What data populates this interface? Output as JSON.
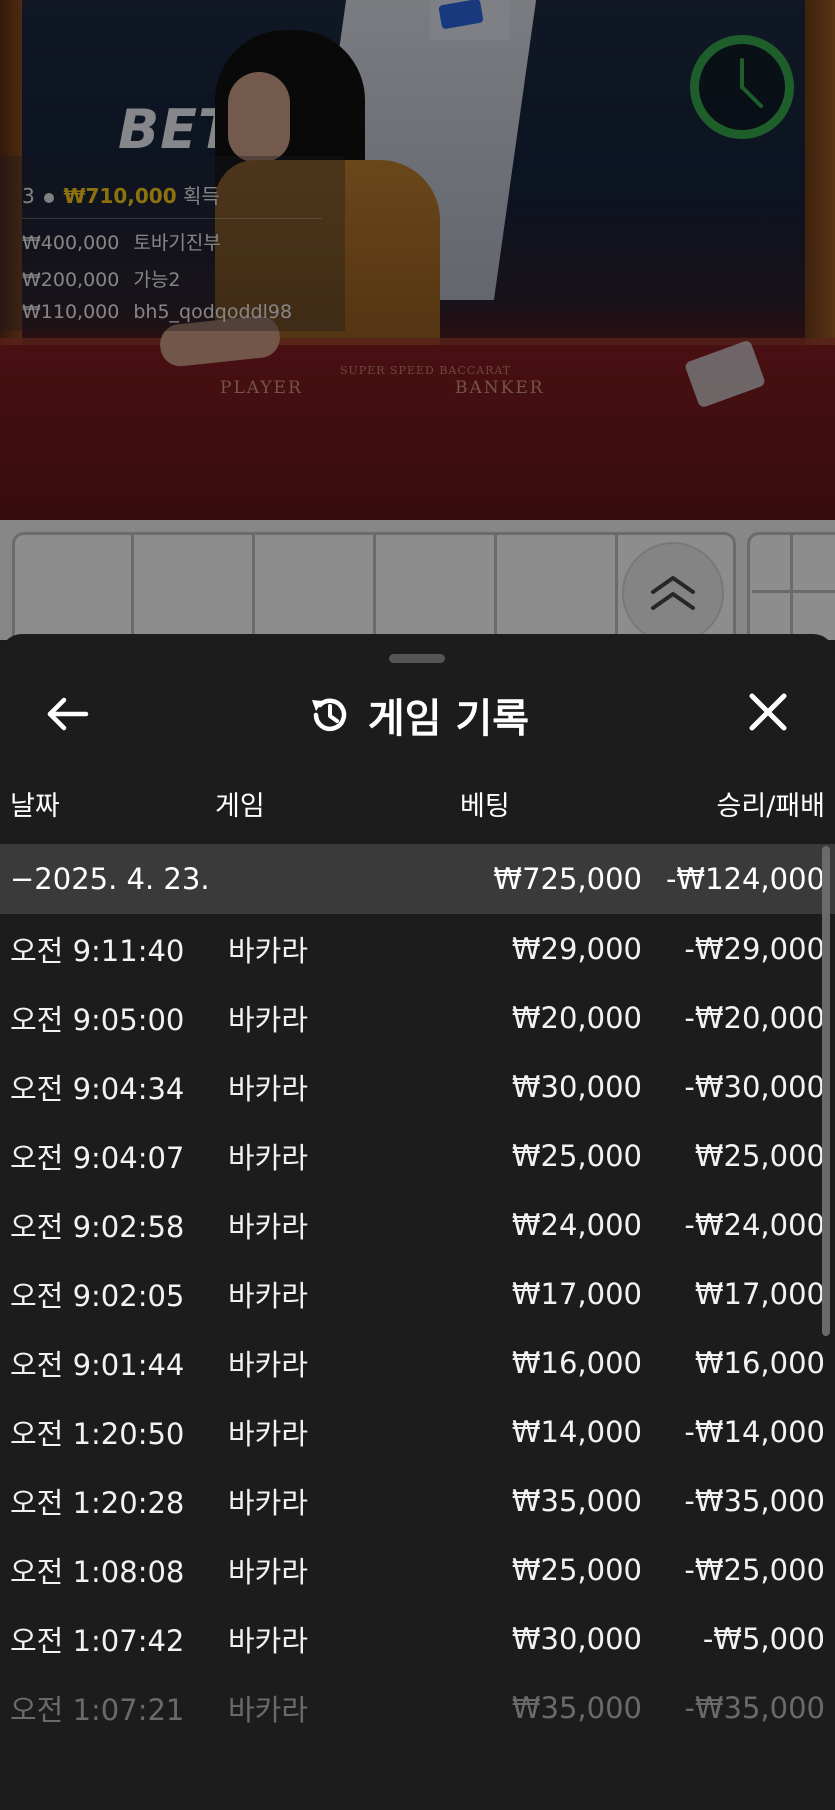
{
  "video": {
    "logo": "BET",
    "felt": {
      "left": "PLAYER",
      "right": "BANKER",
      "sub": "SUPER SPEED BACCARAT"
    },
    "winners": {
      "count": "3",
      "total": "₩710,000",
      "suffix": "획득",
      "list": [
        {
          "amount": "₩400,000",
          "name": "토바기진부"
        },
        {
          "amount": "₩200,000",
          "name": "가능2"
        },
        {
          "amount": "₩110,000",
          "name": "bh5_qodqoddl98"
        }
      ]
    },
    "timer_color": "#33a34a"
  },
  "sheet": {
    "title": "게임 기록",
    "columns": {
      "date": "날짜",
      "game": "게임",
      "bet": "베팅",
      "result": "승리/패배"
    },
    "summary": {
      "date": "−2025. 4. 23.",
      "bet": "₩725,000",
      "result": "-₩124,000"
    },
    "rows": [
      {
        "time": "오전 9:11:40",
        "game": "바카라",
        "bet": "₩29,000",
        "result": "-₩29,000"
      },
      {
        "time": "오전 9:05:00",
        "game": "바카라",
        "bet": "₩20,000",
        "result": "-₩20,000"
      },
      {
        "time": "오전 9:04:34",
        "game": "바카라",
        "bet": "₩30,000",
        "result": "-₩30,000"
      },
      {
        "time": "오전 9:04:07",
        "game": "바카라",
        "bet": "₩25,000",
        "result": "₩25,000"
      },
      {
        "time": "오전 9:02:58",
        "game": "바카라",
        "bet": "₩24,000",
        "result": "-₩24,000"
      },
      {
        "time": "오전 9:02:05",
        "game": "바카라",
        "bet": "₩17,000",
        "result": "₩17,000"
      },
      {
        "time": "오전 9:01:44",
        "game": "바카라",
        "bet": "₩16,000",
        "result": "₩16,000"
      },
      {
        "time": "오전 1:20:50",
        "game": "바카라",
        "bet": "₩14,000",
        "result": "-₩14,000"
      },
      {
        "time": "오전 1:20:28",
        "game": "바카라",
        "bet": "₩35,000",
        "result": "-₩35,000"
      },
      {
        "time": "오전 1:08:08",
        "game": "바카라",
        "bet": "₩25,000",
        "result": "-₩25,000"
      },
      {
        "time": "오전 1:07:42",
        "game": "바카라",
        "bet": "₩30,000",
        "result": "-₩5,000"
      },
      {
        "time": "오전 1:07:21",
        "game": "바카라",
        "bet": "₩35,000",
        "result": "-₩35,000"
      }
    ],
    "icons": {
      "back": "arrow-left-icon",
      "history": "history-icon",
      "close": "close-icon",
      "expand": "chevron-double-up-icon"
    }
  }
}
